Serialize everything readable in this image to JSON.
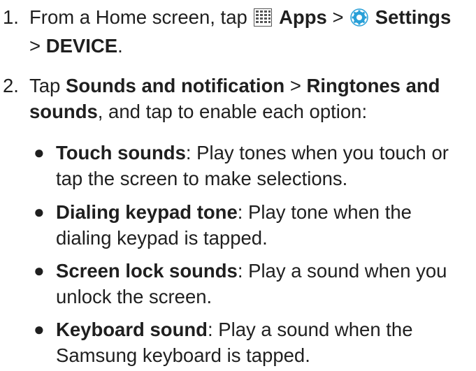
{
  "steps": [
    {
      "number": "1.",
      "line1_pre": "From a Home screen, tap",
      "apps_label": "Apps",
      "separator": ">",
      "settings_label": "Settings",
      "line2_pre": ">",
      "device_label": "DEVICE",
      "line2_post": "."
    },
    {
      "number": "2.",
      "tap": "Tap",
      "sounds_label": "Sounds and notification",
      "separator": ">",
      "ringtones_label_1": "Ringtones and",
      "ringtones_label_2": "sounds",
      "line2_post": ", and tap to enable each option:"
    }
  ],
  "options": [
    {
      "name": "Touch sounds",
      "line1": ": Play tones when you touch or",
      "line2": "tap the screen to make selections."
    },
    {
      "name": "Dialing keypad tone",
      "line1": ": Play tone when the",
      "line2": "dialing keypad is tapped."
    },
    {
      "name": "Screen lock sounds",
      "line1": ": Play a sound when you",
      "line2": "unlock the screen."
    },
    {
      "name": "Keyboard sound",
      "line1": ": Play a sound when the",
      "line2": "Samsung keyboard is tapped."
    }
  ],
  "icons": {
    "apps": "apps-grid-icon",
    "settings": "settings-gear-icon",
    "settings_color": "#2aa0d8"
  }
}
